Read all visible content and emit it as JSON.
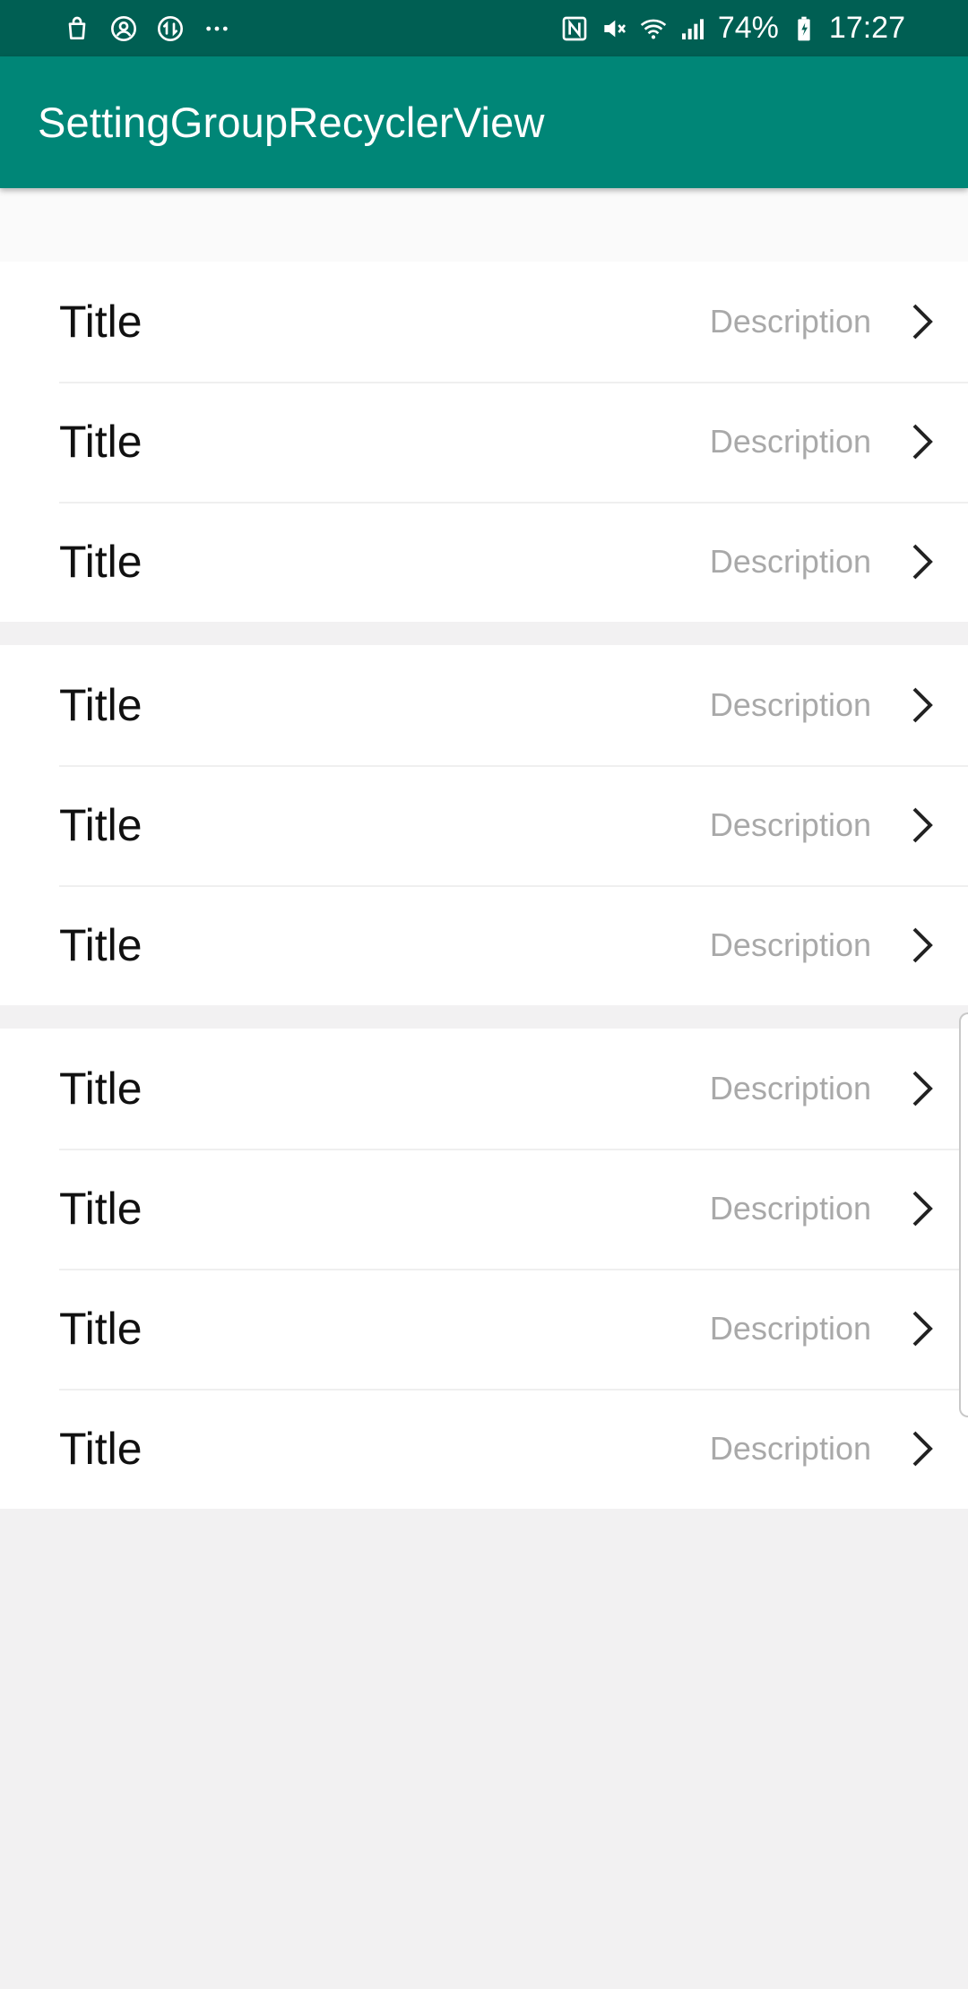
{
  "status_bar": {
    "battery": "74%",
    "time": "17:27",
    "left_icons": [
      "shopping-bag-icon",
      "account-circle-icon",
      "data-sync-icon",
      "more-dots-icon"
    ],
    "right_icons": [
      "nfc-icon",
      "mute-icon",
      "wifi-icon",
      "signal-icon",
      "battery-charging-icon"
    ]
  },
  "app_bar": {
    "title": "SettingGroupRecyclerView",
    "color": "#008677",
    "status_color": "#005f53"
  },
  "groups": [
    {
      "items": [
        {
          "title": "Title",
          "description": "Description"
        },
        {
          "title": "Title",
          "description": "Description"
        },
        {
          "title": "Title",
          "description": "Description"
        }
      ]
    },
    {
      "items": [
        {
          "title": "Title",
          "description": "Description"
        },
        {
          "title": "Title",
          "description": "Description"
        },
        {
          "title": "Title",
          "description": "Description"
        }
      ]
    },
    {
      "items": [
        {
          "title": "Title",
          "description": "Description"
        },
        {
          "title": "Title",
          "description": "Description"
        },
        {
          "title": "Title",
          "description": "Description"
        },
        {
          "title": "Title",
          "description": "Description"
        }
      ]
    }
  ]
}
